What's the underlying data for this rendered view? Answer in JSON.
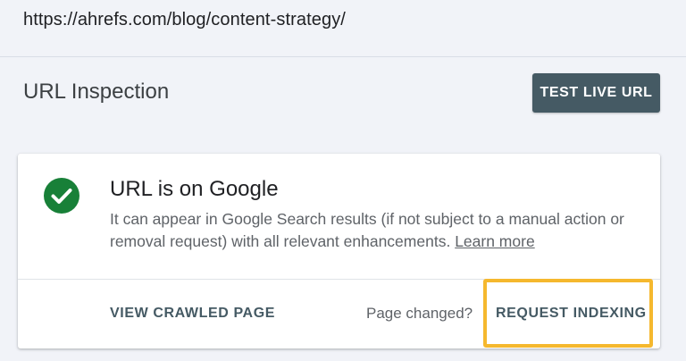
{
  "url_bar": {
    "url": "https://ahrefs.com/blog/content-strategy/"
  },
  "header": {
    "title": "URL Inspection",
    "test_live_url_label": "TEST LIVE URL"
  },
  "status_card": {
    "icon": "check-circle-icon",
    "title": "URL is on Google",
    "description": "It can appear in Google Search results (if not subject to a manual action or removal request) with all relevant enhancements.",
    "learn_more_label": "Learn more",
    "view_crawled_label": "VIEW CRAWLED PAGE",
    "page_changed_text": "Page changed?",
    "request_indexing_label": "REQUEST INDEXING"
  },
  "colors": {
    "background": "#f1f3f8",
    "button": "#455a64",
    "success": "#188038",
    "highlight": "#f5b82e"
  }
}
